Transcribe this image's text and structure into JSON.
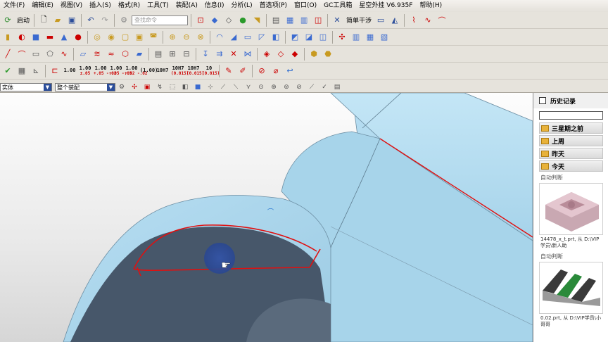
{
  "menubar": {
    "items": [
      "文件(F)",
      "编辑(E)",
      "视图(V)",
      "插入(S)",
      "格式(R)",
      "工具(T)",
      "装配(A)",
      "信息(I)",
      "分析(L)",
      "首选项(P)",
      "窗口(O)",
      "GC工具箱",
      "星空外挂 V6.935F",
      "帮助(H)"
    ]
  },
  "toolbar": {
    "start_label": "启动",
    "search_placeholder": "查找命令",
    "simple_interference_label": "简单干涉",
    "tolerance_buttons": [
      {
        "top": "1.00",
        "sub": ""
      },
      {
        "top": "1.00",
        "sub": "±.05"
      },
      {
        "top": "1.00",
        "sub": "+.05 -.02"
      },
      {
        "top": "1.00",
        "sub": "+.05 -.05"
      },
      {
        "top": "1.00",
        "sub": "+.02 -.02"
      },
      {
        "top": "(1.00)",
        "sub": ""
      },
      {
        "top": "10H7",
        "sub": ""
      },
      {
        "top": "10H7",
        "sub": "(0.015)"
      },
      {
        "top": "10H7",
        "sub": "(0.015)"
      },
      {
        "top": "10",
        "sub": "(0.015)"
      }
    ]
  },
  "selection_bar": {
    "filter_value": "实体",
    "scope_value": "整个装配"
  },
  "history_panel": {
    "title": "历史记录",
    "folders": [
      "三星期之前",
      "上周",
      "昨天",
      "今天"
    ],
    "auto_judge_label_1": "自动判断",
    "caption_1": "14478_x_t.prt, 从 D:\\VIP学员\\新人助",
    "auto_judge_label_2": "自动判断",
    "caption_2": "0.02.prt, 从 D:\\VIP学员\\小哥哥"
  },
  "colors": {
    "model_fill": "#a9d6ec",
    "model_shadow": "#47576a",
    "edge_highlight": "#e01010",
    "cursor_marker": "#2f4c9a",
    "folder": "#e8b23a"
  }
}
